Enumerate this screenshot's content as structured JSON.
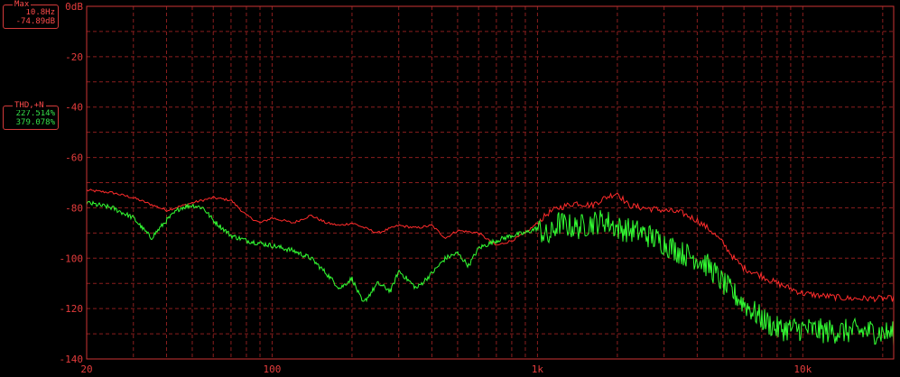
{
  "max_panel": {
    "title": "Max",
    "frequency": "10.8Hz",
    "level": "-74.89dB"
  },
  "thd_panel": {
    "title": "THD,+N",
    "value_1": "227.514%",
    "value_2": "379.078%"
  },
  "chart_data": {
    "type": "line",
    "x_scale": "log",
    "xlim": [
      20,
      22000
    ],
    "ylim": [
      -140,
      0
    ],
    "grid": true,
    "y_ticks": [
      {
        "value": 0,
        "label": "0dB"
      },
      {
        "value": -20,
        "label": "-20"
      },
      {
        "value": -40,
        "label": "-40"
      },
      {
        "value": -60,
        "label": "-60"
      },
      {
        "value": -80,
        "label": "-80"
      },
      {
        "value": -100,
        "label": "-100"
      },
      {
        "value": -120,
        "label": "-120"
      },
      {
        "value": -140,
        "label": "-140"
      }
    ],
    "x_ticks": [
      {
        "value": 20,
        "label": "20"
      },
      {
        "value": 100,
        "label": "100"
      },
      {
        "value": 1000,
        "label": "1k"
      },
      {
        "value": 10000,
        "label": "10k"
      }
    ],
    "series": [
      {
        "color": "#ff2b2b",
        "points": [
          [
            20,
            -73
          ],
          [
            25,
            -74
          ],
          [
            30,
            -76
          ],
          [
            40,
            -81
          ],
          [
            50,
            -78
          ],
          [
            60,
            -76
          ],
          [
            70,
            -77
          ],
          [
            80,
            -83
          ],
          [
            90,
            -86
          ],
          [
            100,
            -84
          ],
          [
            120,
            -86
          ],
          [
            140,
            -83
          ],
          [
            160,
            -86
          ],
          [
            180,
            -87
          ],
          [
            200,
            -86
          ],
          [
            250,
            -90
          ],
          [
            300,
            -87
          ],
          [
            350,
            -88
          ],
          [
            400,
            -87
          ],
          [
            450,
            -92
          ],
          [
            500,
            -89
          ],
          [
            600,
            -90
          ],
          [
            700,
            -95
          ],
          [
            800,
            -93
          ],
          [
            900,
            -90
          ],
          [
            1000,
            -86
          ],
          [
            1100,
            -82
          ],
          [
            1200,
            -80
          ],
          [
            1400,
            -78
          ],
          [
            1600,
            -79
          ],
          [
            1800,
            -76
          ],
          [
            2000,
            -74
          ],
          [
            2200,
            -79
          ],
          [
            2500,
            -80
          ],
          [
            3000,
            -81
          ],
          [
            3500,
            -82
          ],
          [
            4000,
            -85
          ],
          [
            4500,
            -89
          ],
          [
            5000,
            -94
          ],
          [
            5500,
            -100
          ],
          [
            6000,
            -104
          ],
          [
            7000,
            -107
          ],
          [
            8000,
            -110
          ],
          [
            9000,
            -112
          ],
          [
            10000,
            -114
          ],
          [
            12000,
            -115
          ],
          [
            15000,
            -116
          ],
          [
            18000,
            -116
          ],
          [
            22000,
            -116
          ]
        ]
      },
      {
        "color": "#33ff33",
        "points": [
          [
            20,
            -78
          ],
          [
            25,
            -80
          ],
          [
            30,
            -84
          ],
          [
            35,
            -92
          ],
          [
            40,
            -85
          ],
          [
            45,
            -80
          ],
          [
            50,
            -79
          ],
          [
            55,
            -80
          ],
          [
            60,
            -85
          ],
          [
            70,
            -91
          ],
          [
            80,
            -93
          ],
          [
            100,
            -95
          ],
          [
            120,
            -97
          ],
          [
            140,
            -100
          ],
          [
            160,
            -106
          ],
          [
            180,
            -112
          ],
          [
            200,
            -108
          ],
          [
            220,
            -118
          ],
          [
            250,
            -110
          ],
          [
            280,
            -113
          ],
          [
            300,
            -105
          ],
          [
            350,
            -112
          ],
          [
            400,
            -106
          ],
          [
            450,
            -100
          ],
          [
            500,
            -98
          ],
          [
            550,
            -103
          ],
          [
            600,
            -96
          ],
          [
            700,
            -93
          ],
          [
            800,
            -91
          ],
          [
            900,
            -90
          ],
          [
            1000,
            -88
          ],
          [
            1100,
            -92
          ],
          [
            1200,
            -86
          ],
          [
            1400,
            -88
          ],
          [
            1600,
            -86
          ],
          [
            1800,
            -85
          ],
          [
            2000,
            -88
          ],
          [
            2500,
            -90
          ],
          [
            3000,
            -94
          ],
          [
            3500,
            -98
          ],
          [
            4000,
            -100
          ],
          [
            4500,
            -104
          ],
          [
            5000,
            -110
          ],
          [
            6000,
            -118
          ],
          [
            7000,
            -124
          ],
          [
            8000,
            -128
          ],
          [
            10000,
            -128
          ],
          [
            12000,
            -129
          ],
          [
            15000,
            -129
          ],
          [
            18000,
            -129
          ],
          [
            22000,
            -130
          ]
        ]
      }
    ]
  }
}
